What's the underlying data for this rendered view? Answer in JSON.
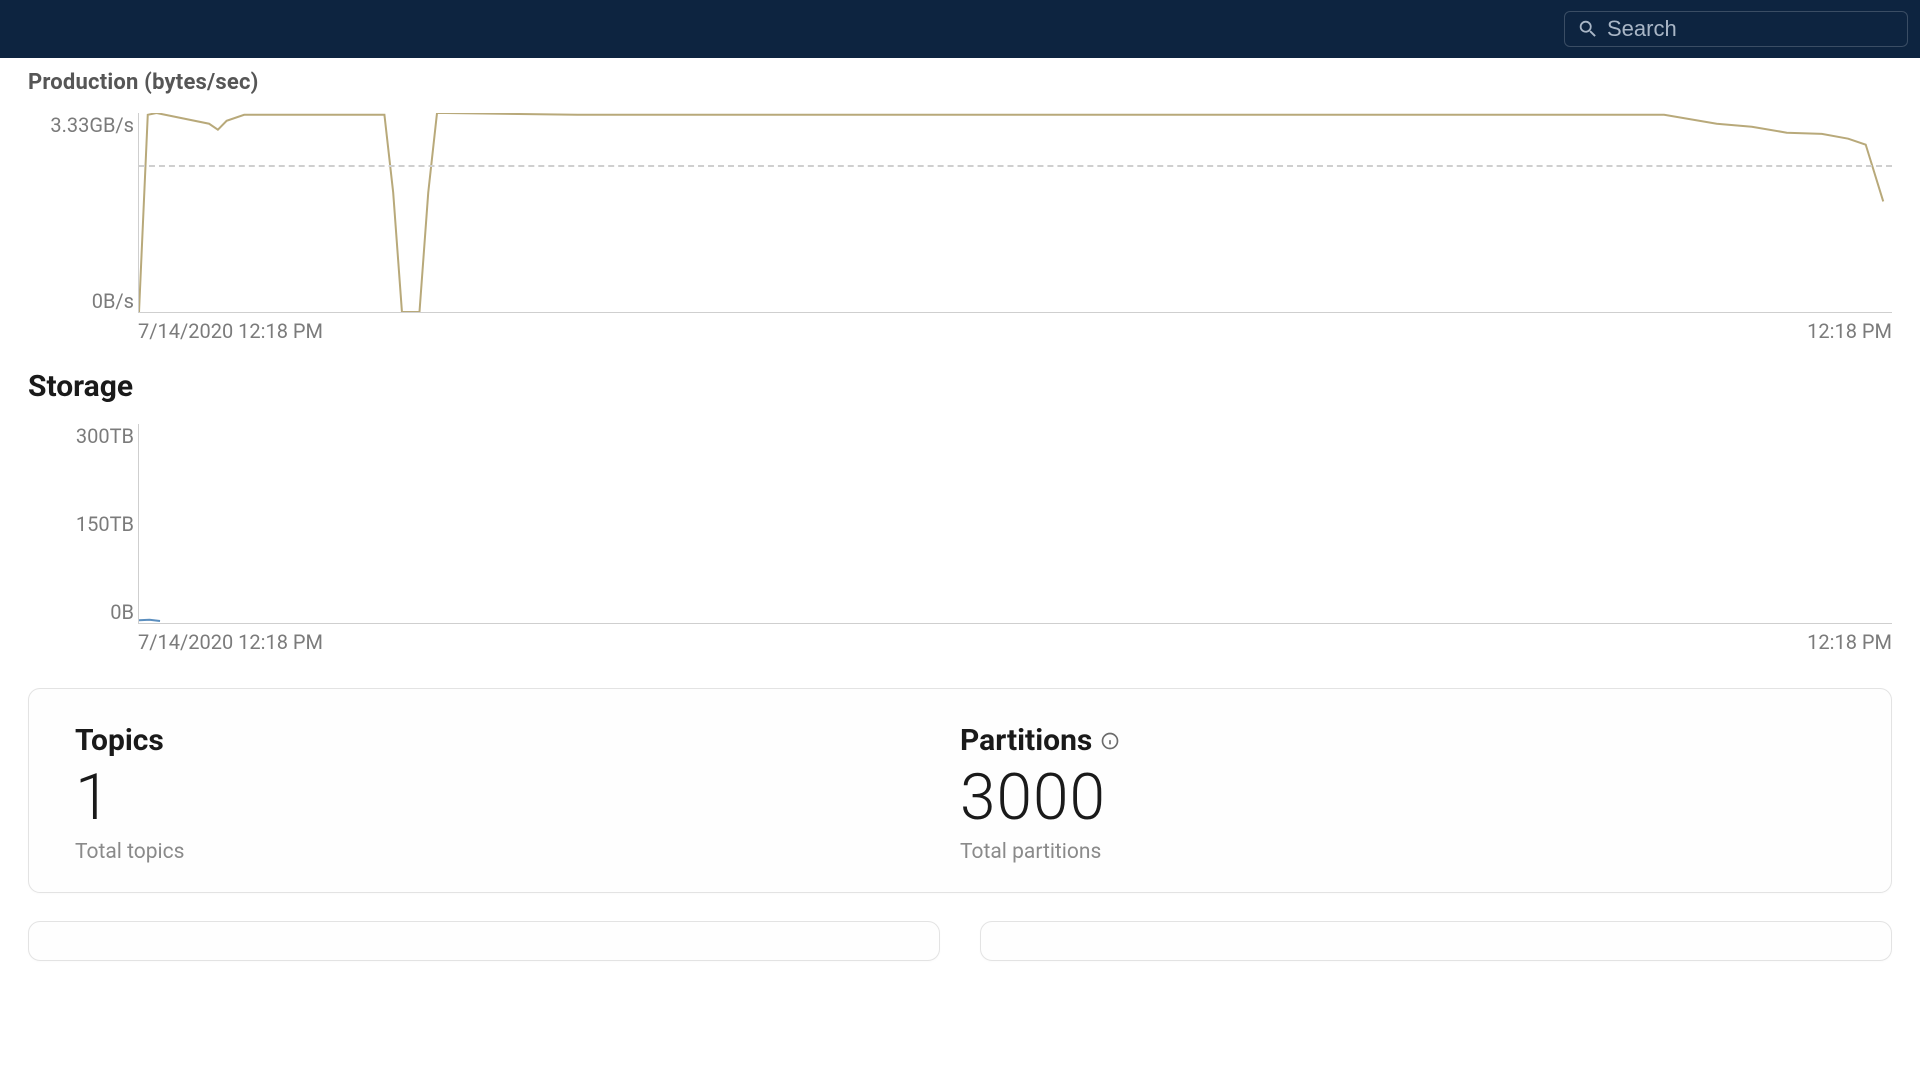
{
  "header": {
    "search_placeholder": "Search"
  },
  "production": {
    "title": "Production (bytes/sec)",
    "y_top": "3.33GB/s",
    "y_bottom": "0B/s",
    "x_left": "7/14/2020 12:18 PM",
    "x_right": "12:18 PM"
  },
  "storage": {
    "title": "Storage",
    "y_top": "300TB",
    "y_mid": "150TB",
    "y_bottom": "0B",
    "x_left": "7/14/2020 12:18 PM",
    "x_right": "12:18 PM"
  },
  "cards": {
    "topics": {
      "title": "Topics",
      "value": "1",
      "sub": "Total topics"
    },
    "partitions": {
      "title": "Partitions",
      "value": "3000",
      "sub": "Total partitions"
    }
  },
  "chart_data": [
    {
      "type": "line",
      "title": "Production (bytes/sec)",
      "xlabel": "",
      "ylabel": "",
      "x_range": [
        "7/14/2020 12:18 PM",
        "12:18 PM"
      ],
      "ylim_gbps": [
        0,
        3.33
      ],
      "series": [
        {
          "name": "production",
          "color": "#b8a97a",
          "x_frac": [
            0.0,
            0.005,
            0.01,
            0.04,
            0.045,
            0.05,
            0.06,
            0.14,
            0.145,
            0.15,
            0.155,
            0.16,
            0.165,
            0.17,
            0.175,
            0.25,
            0.5,
            0.75,
            0.87,
            0.9,
            0.92,
            0.94,
            0.96,
            0.975,
            0.985,
            0.995
          ],
          "y_gbps": [
            0.0,
            3.3,
            3.33,
            3.15,
            3.05,
            3.2,
            3.3,
            3.3,
            2.0,
            0.0,
            0.0,
            0.0,
            2.0,
            3.33,
            3.33,
            3.3,
            3.3,
            3.3,
            3.3,
            3.15,
            3.1,
            3.0,
            2.98,
            2.9,
            2.8,
            1.85
          ]
        }
      ],
      "grid_dash_at_gbps": 2.5
    },
    {
      "type": "line",
      "title": "Storage",
      "xlabel": "",
      "ylabel": "",
      "x_range": [
        "7/14/2020 12:18 PM",
        "12:18 PM"
      ],
      "ylim_tb": [
        0,
        300
      ],
      "y_ticks_tb": [
        0,
        150,
        300
      ],
      "series": [
        {
          "name": "storage",
          "color": "#5c8fbf",
          "x_frac": [
            0.0,
            0.006,
            0.012
          ],
          "y_tb": [
            4,
            5,
            3
          ]
        }
      ]
    }
  ]
}
